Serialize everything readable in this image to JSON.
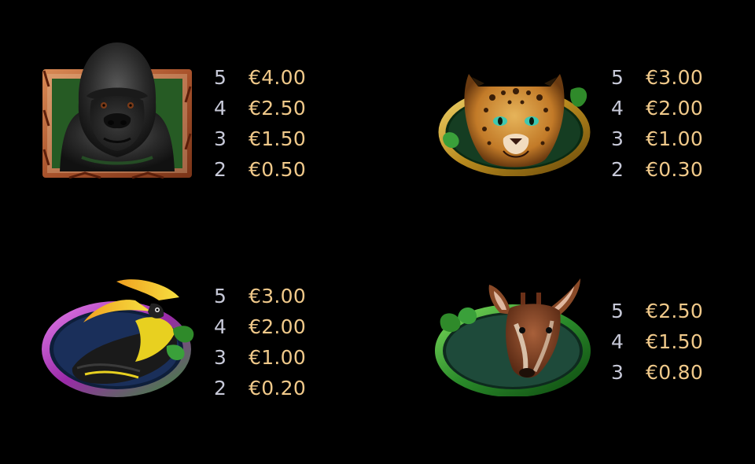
{
  "colors": {
    "background": "#000000",
    "count_text": "#c7c9d8",
    "value_text": "#f0c98a"
  },
  "symbols": [
    {
      "name": "gorilla",
      "icon": "gorilla-symbol-icon",
      "pays": [
        {
          "count": "5",
          "value": "€4.00"
        },
        {
          "count": "4",
          "value": "€2.50"
        },
        {
          "count": "3",
          "value": "€1.50"
        },
        {
          "count": "2",
          "value": "€0.50"
        }
      ]
    },
    {
      "name": "leopard",
      "icon": "leopard-symbol-icon",
      "pays": [
        {
          "count": "5",
          "value": "€3.00"
        },
        {
          "count": "4",
          "value": "€2.00"
        },
        {
          "count": "3",
          "value": "€1.00"
        },
        {
          "count": "2",
          "value": "€0.30"
        }
      ]
    },
    {
      "name": "hornbill",
      "icon": "hornbill-symbol-icon",
      "pays": [
        {
          "count": "5",
          "value": "€3.00"
        },
        {
          "count": "4",
          "value": "€2.00"
        },
        {
          "count": "3",
          "value": "€1.00"
        },
        {
          "count": "2",
          "value": "€0.20"
        }
      ]
    },
    {
      "name": "okapi",
      "icon": "okapi-symbol-icon",
      "pays": [
        {
          "count": "5",
          "value": "€2.50"
        },
        {
          "count": "4",
          "value": "€1.50"
        },
        {
          "count": "3",
          "value": "€0.80"
        }
      ]
    }
  ]
}
